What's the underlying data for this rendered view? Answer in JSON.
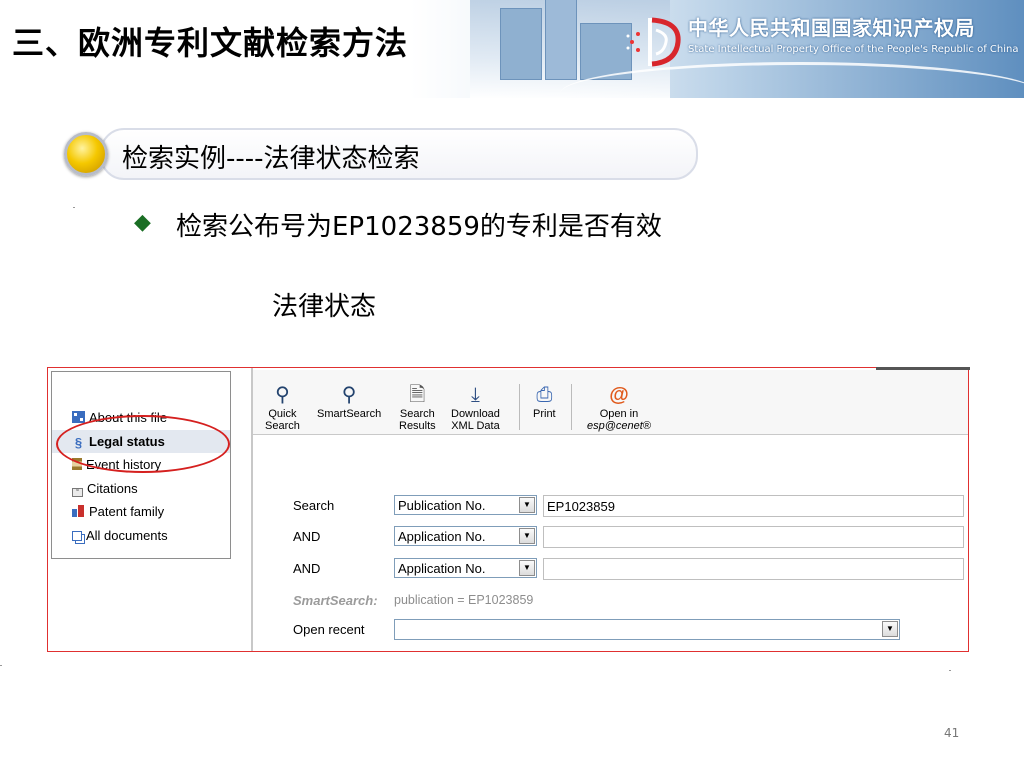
{
  "header": {
    "title": "三、欧洲专利文献检索方法",
    "org_name_cn": "中华人民共和国国家知识产权局",
    "org_name_en": "State Intellectual Property Office of the People's Republic of China"
  },
  "section": {
    "heading": "检索实例----法律状态检索",
    "task": "检索公布号为EP1023859的专利是否有效",
    "status_label": "法律状态"
  },
  "screenshot": {
    "nav_items": [
      {
        "label": "About this file",
        "icon": "about-icon",
        "active": false
      },
      {
        "label": "Legal status",
        "icon": "section-symbol-icon",
        "active": true
      },
      {
        "label": "Event history",
        "icon": "hourglass-icon",
        "active": false
      },
      {
        "label": "Citations",
        "icon": "quote-icon",
        "active": false
      },
      {
        "label": "Patent family",
        "icon": "family-icon",
        "active": false
      },
      {
        "label": "All documents",
        "icon": "documents-icon",
        "active": false
      }
    ],
    "toolbar": {
      "quick_search": {
        "line1": "Quick",
        "line2": "Search",
        "icon": "magnifier-icon"
      },
      "smart_search": {
        "line1": "SmartSearch",
        "icon": "magnifier-icon"
      },
      "search_results": {
        "line1": "Search",
        "line2": "Results",
        "icon": "results-icon"
      },
      "download": {
        "line1": "Download",
        "line2": "XML Data",
        "icon": "download-icon"
      },
      "print": {
        "line1": "Print",
        "icon": "printer-icon"
      },
      "open_in": {
        "line1": "Open in",
        "line2": "esp@cenet®",
        "icon": "at-icon"
      }
    },
    "form": {
      "row1": {
        "label": "Search",
        "select": "Publication No.",
        "value": "EP1023859"
      },
      "row2": {
        "label": "AND",
        "select": "Application No.",
        "value": ""
      },
      "row3": {
        "label": "AND",
        "select": "Application No.",
        "value": ""
      },
      "smart": {
        "label": "SmartSearch:",
        "value": "publication = EP1023859"
      },
      "recent": {
        "label": "Open recent",
        "value": ""
      }
    }
  },
  "page_number": "41"
}
